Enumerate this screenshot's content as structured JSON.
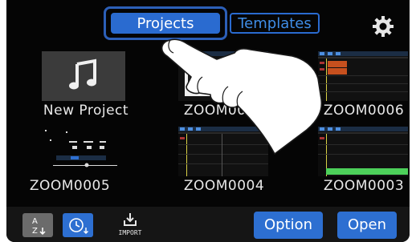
{
  "tabs": [
    {
      "label": "Projects",
      "selected": true
    },
    {
      "label": "Templates",
      "selected": false
    }
  ],
  "settings_icon": "gear-icon",
  "projects": [
    {
      "label": "New Project",
      "icon": "music-note-icon"
    },
    {
      "label": "ZOOM0008"
    },
    {
      "label": "ZOOM0006"
    },
    {
      "label": "ZOOM0005"
    },
    {
      "label": "ZOOM0004"
    },
    {
      "label": "ZOOM0003"
    }
  ],
  "bottom_bar": {
    "sort_alpha_icon": "sort-az-icon",
    "sort_time_icon": "sort-time-icon",
    "import_label": "IMPORT",
    "option_label": "Option",
    "open_label": "Open"
  },
  "colors": {
    "accent": "#2d6fd1",
    "background": "#050505",
    "text": "#e8e8e8"
  }
}
